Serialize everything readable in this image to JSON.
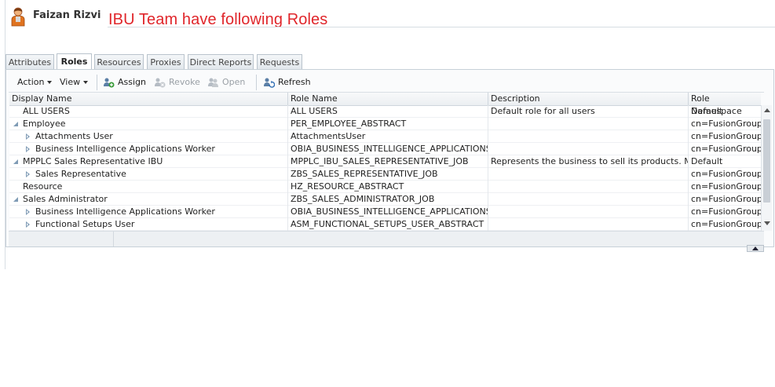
{
  "header": {
    "user_name": "Faizan Rizvi",
    "annotation": "IBU Team have following Roles",
    "annotation_color": "#e0262b"
  },
  "tabs": [
    {
      "label": "Attributes",
      "active": false
    },
    {
      "label": "Roles",
      "active": true
    },
    {
      "label": "Resources",
      "active": false
    },
    {
      "label": "Proxies",
      "active": false
    },
    {
      "label": "Direct Reports",
      "active": false
    },
    {
      "label": "Requests",
      "active": false
    }
  ],
  "toolbar": {
    "action_label": "Action",
    "view_label": "View",
    "assign_label": "Assign",
    "revoke_label": "Revoke",
    "open_label": "Open",
    "refresh_label": "Refresh"
  },
  "table": {
    "columns": [
      "Display Name",
      "Role Name",
      "Description",
      "Role Namespace"
    ],
    "rows": [
      {
        "display_name": "ALL USERS",
        "role_name": "ALL USERS",
        "description": "Default role for all users",
        "namespace": "Default",
        "level": 0,
        "toggle": "none"
      },
      {
        "display_name": "Employee",
        "role_name": "PER_EMPLOYEE_ABSTRACT",
        "description": "",
        "namespace": "cn=FusionGroups,",
        "level": 0,
        "toggle": "expanded"
      },
      {
        "display_name": "Attachments User",
        "role_name": "AttachmentsUser",
        "description": "",
        "namespace": "cn=FusionGroups,",
        "level": 1,
        "toggle": "collapsed"
      },
      {
        "display_name": "Business Intelligence Applications Worker",
        "role_name": "OBIA_BUSINESS_INTELLIGENCE_APPLICATIONS_...",
        "description": "",
        "namespace": "cn=FusionGroups,",
        "level": 1,
        "toggle": "collapsed"
      },
      {
        "display_name": "MPPLC Sales Representative IBU",
        "role_name": "MPPLC_IBU_SALES_REPRESENTATIVE_JOB",
        "description": "Represents the business to sell its products. Main...",
        "namespace": "Default",
        "level": 0,
        "toggle": "expanded"
      },
      {
        "display_name": "Sales Representative",
        "role_name": "ZBS_SALES_REPRESENTATIVE_JOB",
        "description": "",
        "namespace": "cn=FusionGroups,",
        "level": 1,
        "toggle": "collapsed"
      },
      {
        "display_name": "Resource",
        "role_name": "HZ_RESOURCE_ABSTRACT",
        "description": "",
        "namespace": "cn=FusionGroups,",
        "level": 0,
        "toggle": "none"
      },
      {
        "display_name": "Sales Administrator",
        "role_name": "ZBS_SALES_ADMINISTRATOR_JOB",
        "description": "",
        "namespace": "cn=FusionGroups,",
        "level": 0,
        "toggle": "expanded"
      },
      {
        "display_name": "Business Intelligence Applications Worker",
        "role_name": "OBIA_BUSINESS_INTELLIGENCE_APPLICATIONS_...",
        "description": "",
        "namespace": "cn=FusionGroups,",
        "level": 1,
        "toggle": "collapsed"
      },
      {
        "display_name": "Functional Setups User",
        "role_name": "ASM_FUNCTIONAL_SETUPS_USER_ABSTRACT",
        "description": "",
        "namespace": "cn=FusionGroups,",
        "level": 1,
        "toggle": "collapsed"
      }
    ]
  }
}
